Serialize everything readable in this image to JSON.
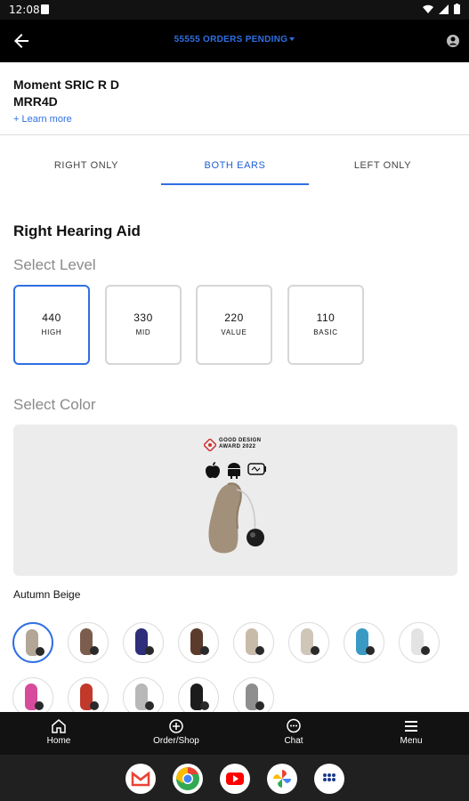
{
  "status_bar": {
    "time": "12:08"
  },
  "header": {
    "orders_pending": "55555 ORDERS PENDING"
  },
  "product": {
    "name": "Moment SRIC R D",
    "code": "MRR4D",
    "learn_more": "+ Learn more"
  },
  "tabs": [
    {
      "label": "RIGHT ONLY",
      "active": false
    },
    {
      "label": "BOTH EARS",
      "active": true
    },
    {
      "label": "LEFT ONLY",
      "active": false
    }
  ],
  "section": {
    "title": "Right Hearing Aid",
    "select_level": "Select Level",
    "select_color": "Select Color"
  },
  "levels": [
    {
      "number": "440",
      "name": "HIGH",
      "selected": true
    },
    {
      "number": "330",
      "name": "MID",
      "selected": false
    },
    {
      "number": "220",
      "name": "VALUE",
      "selected": false
    },
    {
      "number": "110",
      "name": "BASIC",
      "selected": false
    }
  ],
  "color_preview": {
    "award_line1": "GOOD DESIGN",
    "award_line2": "AWARD 2022"
  },
  "selected_color": "Autumn Beige",
  "swatches": [
    "#b3a696",
    "#7a5d4c",
    "#2d2f7a",
    "#5b3b2c",
    "#c8bba9",
    "#cfc6b8",
    "#3a9ac4",
    "#e3e3e3",
    "#d64b9c",
    "#c0392b",
    "#b8b8b8",
    "#1c1c1c",
    "#8e8e8e"
  ],
  "bottom_nav": [
    {
      "label": "Home"
    },
    {
      "label": "Order/Shop"
    },
    {
      "label": "Chat"
    },
    {
      "label": "Menu"
    }
  ],
  "accent_color": "#2f6fe3"
}
